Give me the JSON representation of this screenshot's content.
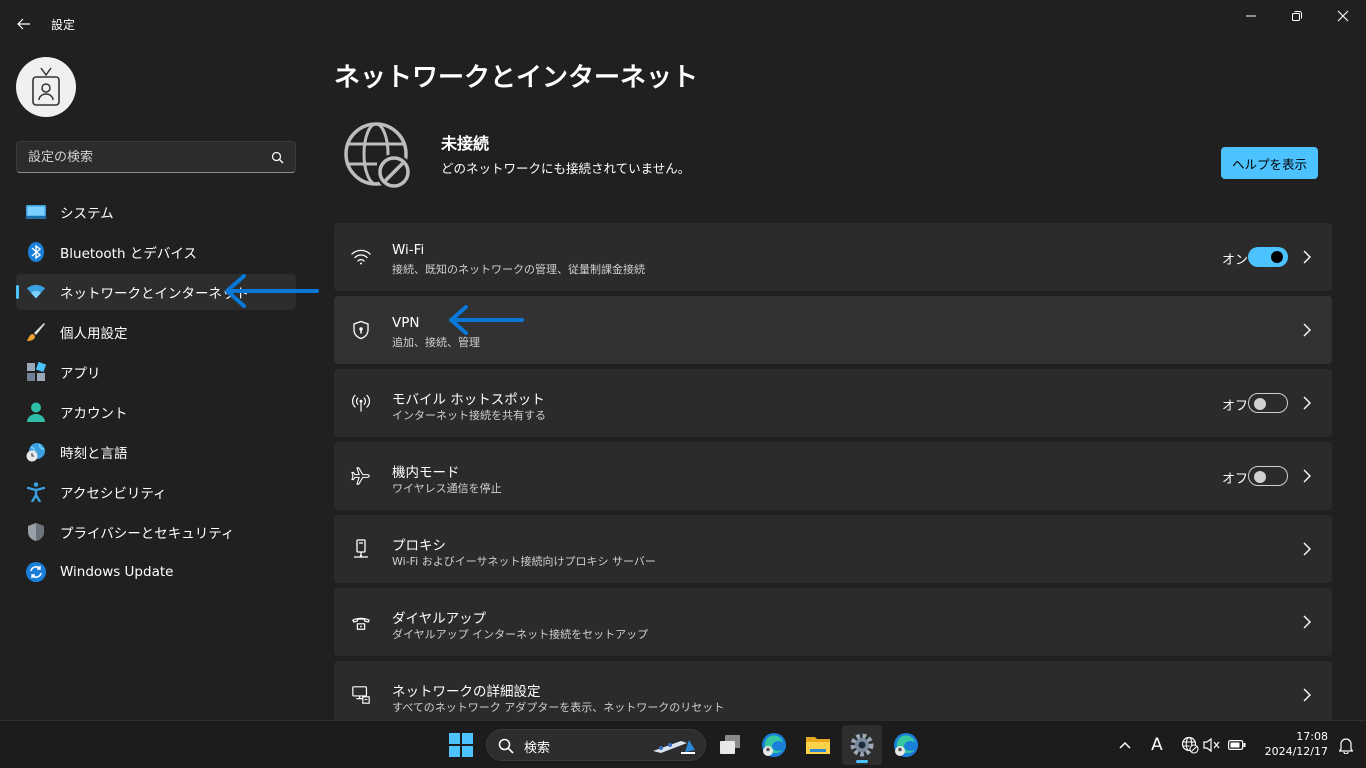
{
  "window": {
    "title": "設定"
  },
  "sidebar": {
    "search_placeholder": "設定の検索",
    "items": [
      {
        "label": "システム",
        "icon": "monitor-icon"
      },
      {
        "label": "Bluetooth とデバイス",
        "icon": "bluetooth-icon"
      },
      {
        "label": "ネットワークとインターネット",
        "icon": "wifi-icon",
        "active": true
      },
      {
        "label": "個人用設定",
        "icon": "paintbrush-icon"
      },
      {
        "label": "アプリ",
        "icon": "apps-icon"
      },
      {
        "label": "アカウント",
        "icon": "person-icon"
      },
      {
        "label": "時刻と言語",
        "icon": "globe-clock-icon"
      },
      {
        "label": "アクセシビリティ",
        "icon": "accessibility-icon"
      },
      {
        "label": "プライバシーとセキュリティ",
        "icon": "shield-icon"
      },
      {
        "label": "Windows Update",
        "icon": "update-icon"
      }
    ]
  },
  "main": {
    "title": "ネットワークとインターネット",
    "status": {
      "title": "未接続",
      "description": "どのネットワークにも接続されていません。",
      "help_button": "ヘルプを表示"
    },
    "rows": [
      {
        "title": "Wi-Fi",
        "subtitle": "接続、既知のネットワークの管理、従量制課金接続",
        "toggle": "オン",
        "icon": "wifi-icon"
      },
      {
        "title": "VPN",
        "subtitle": "追加、接続、管理",
        "icon": "vpn-shield-icon"
      },
      {
        "title": "モバイル ホットスポット",
        "subtitle": "インターネット接続を共有する",
        "toggle": "オフ",
        "icon": "hotspot-icon"
      },
      {
        "title": "機内モード",
        "subtitle": "ワイヤレス通信を停止",
        "toggle": "オフ",
        "icon": "airplane-icon"
      },
      {
        "title": "プロキシ",
        "subtitle": "Wi-Fi およびイーサネット接続向けプロキシ サーバー",
        "icon": "proxy-icon"
      },
      {
        "title": "ダイヤルアップ",
        "subtitle": "ダイヤルアップ インターネット接続をセットアップ",
        "icon": "dialup-icon"
      },
      {
        "title": "ネットワークの詳細設定",
        "subtitle": "すべてのネットワーク アダプターを表示、ネットワークのリセット",
        "icon": "network-pc-icon"
      }
    ]
  },
  "taskbar": {
    "search_label": "検索",
    "clock_time": "17:08",
    "clock_date": "2024/12/17",
    "ime_label": "A"
  },
  "colors": {
    "accent": "#4cc2ff",
    "arrow": "#0a78d7"
  }
}
